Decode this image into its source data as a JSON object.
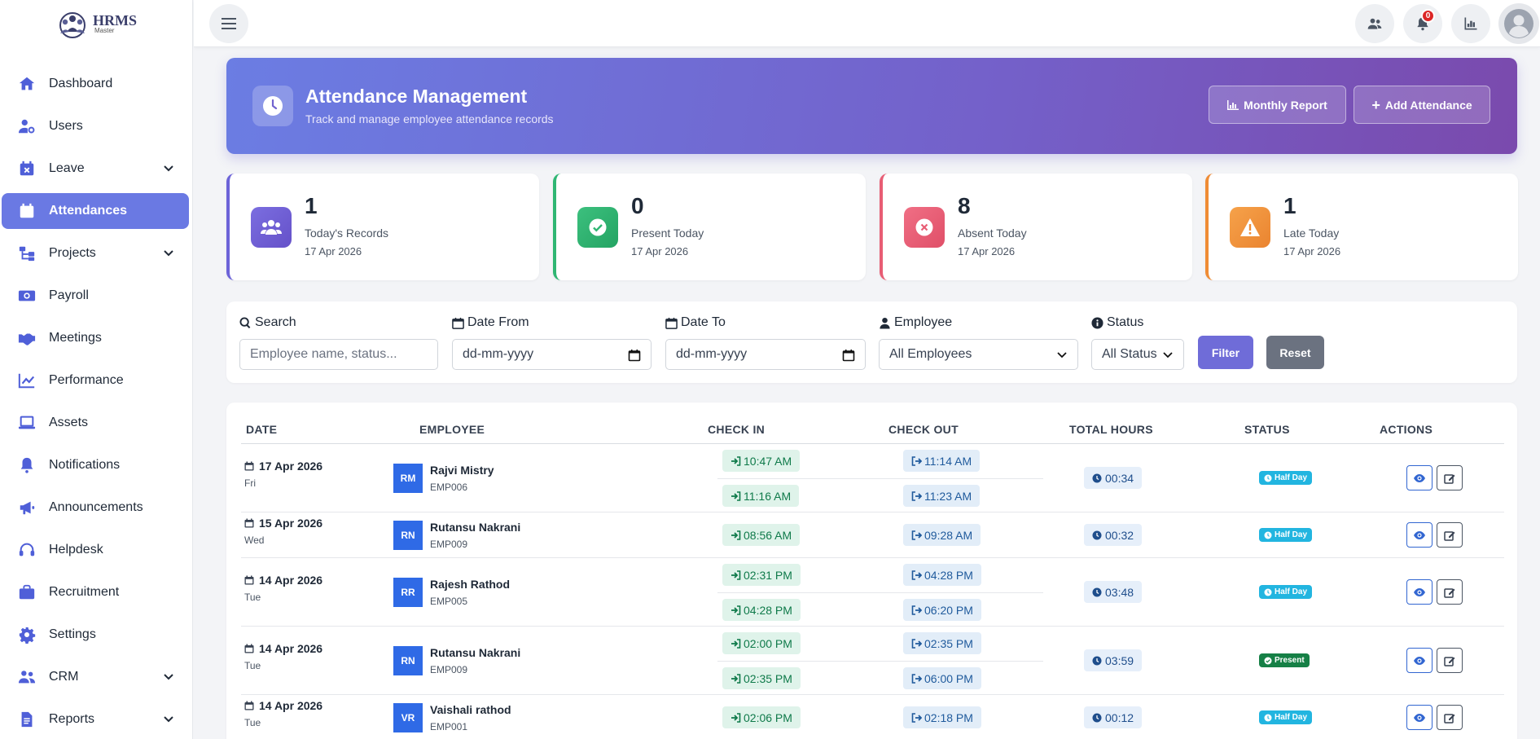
{
  "brand": {
    "name": "HRMS",
    "subtitle": "Master"
  },
  "sidebar": {
    "items": [
      {
        "label": "Dashboard",
        "icon": "home-icon",
        "expandable": false,
        "active": false
      },
      {
        "label": "Users",
        "icon": "user-gear-icon",
        "expandable": false,
        "active": false
      },
      {
        "label": "Leave",
        "icon": "calendar-x-icon",
        "expandable": true,
        "active": false
      },
      {
        "label": "Attendances",
        "icon": "calendar-icon",
        "expandable": false,
        "active": true
      },
      {
        "label": "Projects",
        "icon": "sitemap-icon",
        "expandable": true,
        "active": false
      },
      {
        "label": "Payroll",
        "icon": "money-icon",
        "expandable": false,
        "active": false
      },
      {
        "label": "Meetings",
        "icon": "handshake-icon",
        "expandable": false,
        "active": false
      },
      {
        "label": "Performance",
        "icon": "chart-line-icon",
        "expandable": false,
        "active": false
      },
      {
        "label": "Assets",
        "icon": "laptop-icon",
        "expandable": false,
        "active": false
      },
      {
        "label": "Notifications",
        "icon": "bell-icon",
        "expandable": false,
        "active": false
      },
      {
        "label": "Announcements",
        "icon": "megaphone-icon",
        "expandable": false,
        "active": false
      },
      {
        "label": "Helpdesk",
        "icon": "headset-icon",
        "expandable": false,
        "active": false
      },
      {
        "label": "Recruitment",
        "icon": "briefcase-icon",
        "expandable": false,
        "active": false
      },
      {
        "label": "Settings",
        "icon": "gear-icon",
        "expandable": false,
        "active": false
      },
      {
        "label": "CRM",
        "icon": "users-icon",
        "expandable": true,
        "active": false
      },
      {
        "label": "Reports",
        "icon": "file-icon",
        "expandable": true,
        "active": false
      }
    ]
  },
  "topbar": {
    "notification_count": "0"
  },
  "hero": {
    "title": "Attendance Management",
    "subtitle": "Track and manage employee attendance records",
    "monthly_report_label": "Monthly Report",
    "add_attendance_label": "Add Attendance"
  },
  "stats": [
    {
      "value": "1",
      "label": "Today's Records",
      "date": "17 Apr 2026",
      "color": "#6c63d8"
    },
    {
      "value": "0",
      "label": "Present Today",
      "date": "17 Apr 2026",
      "color": "#2fb673"
    },
    {
      "value": "8",
      "label": "Absent Today",
      "date": "17 Apr 2026",
      "color": "#e85d74"
    },
    {
      "value": "1",
      "label": "Late Today",
      "date": "17 Apr 2026",
      "color": "#ef8c35"
    }
  ],
  "filters": {
    "search_label": "Search",
    "search_placeholder": "Employee name, status...",
    "date_from_label": "Date From",
    "date_from_value": "dd-mm-yyyy",
    "date_to_label": "Date To",
    "date_to_value": "dd-mm-yyyy",
    "employee_label": "Employee",
    "employee_value": "All Employees",
    "status_label": "Status",
    "status_value": "All Status",
    "filter_button": "Filter",
    "reset_button": "Reset"
  },
  "table": {
    "headers": [
      "DATE",
      "EMPLOYEE",
      "CHECK IN",
      "CHECK OUT",
      "TOTAL HOURS",
      "STATUS",
      "ACTIONS"
    ],
    "rows": [
      {
        "date": "17 Apr 2026",
        "weekday": "Fri",
        "initials": "RM",
        "name": "Rajvi Mistry",
        "emp_id": "EMP006",
        "sessions": [
          {
            "in": "10:47 AM",
            "out": "11:14 AM"
          },
          {
            "in": "11:16 AM",
            "out": "11:23 AM"
          }
        ],
        "hours": "00:34",
        "status": "Half Day"
      },
      {
        "date": "15 Apr 2026",
        "weekday": "Wed",
        "initials": "RN",
        "name": "Rutansu Nakrani",
        "emp_id": "EMP009",
        "sessions": [
          {
            "in": "08:56 AM",
            "out": "09:28 AM"
          }
        ],
        "hours": "00:32",
        "status": "Half Day"
      },
      {
        "date": "14 Apr 2026",
        "weekday": "Tue",
        "initials": "RR",
        "name": "Rajesh Rathod",
        "emp_id": "EMP005",
        "sessions": [
          {
            "in": "02:31 PM",
            "out": "04:28 PM"
          },
          {
            "in": "04:28 PM",
            "out": "06:20 PM"
          }
        ],
        "hours": "03:48",
        "status": "Half Day"
      },
      {
        "date": "14 Apr 2026",
        "weekday": "Tue",
        "initials": "RN",
        "name": "Rutansu Nakrani",
        "emp_id": "EMP009",
        "sessions": [
          {
            "in": "02:00 PM",
            "out": "02:35 PM"
          },
          {
            "in": "02:35 PM",
            "out": "06:00 PM"
          }
        ],
        "hours": "03:59",
        "status": "Present"
      },
      {
        "date": "14 Apr 2026",
        "weekday": "Tue",
        "initials": "VR",
        "name": "Vaishali rathod",
        "emp_id": "EMP001",
        "sessions": [
          {
            "in": "02:06 PM",
            "out": "02:18 PM"
          }
        ],
        "hours": "00:12",
        "status": "Half Day"
      }
    ]
  }
}
